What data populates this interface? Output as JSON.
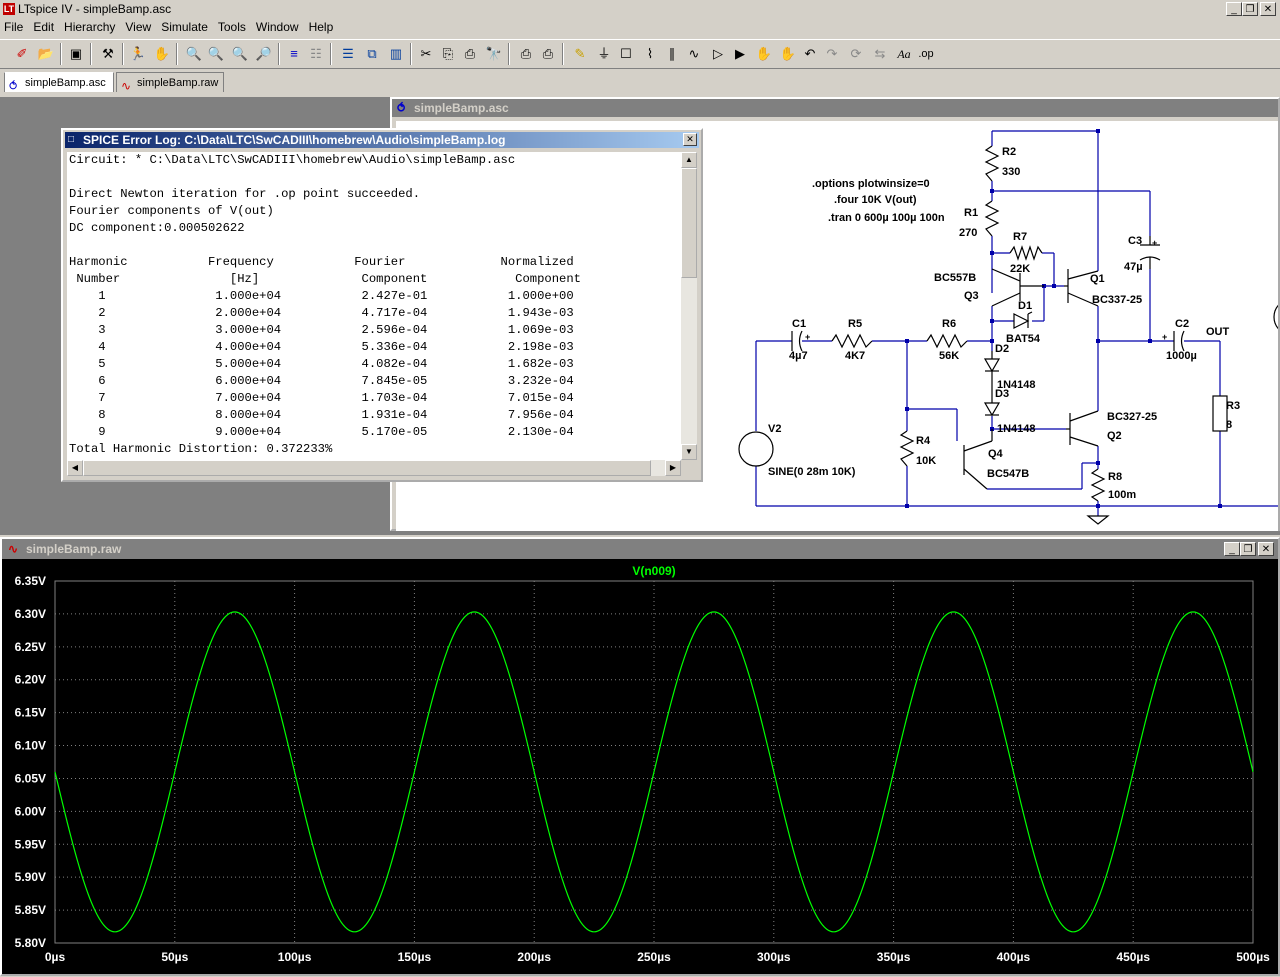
{
  "app": {
    "title": "LTspice IV - simpleBamp.asc",
    "logo_text": "LT"
  },
  "window_controls": {
    "minimize": "_",
    "restore": "❐",
    "close": "✕"
  },
  "menu": [
    "File",
    "Edit",
    "Hierarchy",
    "View",
    "Simulate",
    "Tools",
    "Window",
    "Help"
  ],
  "toolbar": {
    "icons": [
      "new-schematic-icon",
      "open-icon",
      "save-icon",
      "control-panel-icon",
      "run-icon",
      "halt-icon",
      "zoom-in-icon",
      "pan-icon",
      "zoom-out-icon",
      "zoom-fit-icon",
      "autorange-icon",
      "grid-icon",
      "tile-horizontal-icon",
      "cascade-icon",
      "tile-vertical-icon",
      "cut-icon",
      "copy-icon",
      "paste-icon",
      "find-icon",
      "print-setup-icon",
      "print-icon",
      "wire-icon",
      "ground-icon",
      "label-icon",
      "resistor-icon",
      "capacitor-icon",
      "inductor-icon",
      "diode-icon",
      "component-icon",
      "move-icon",
      "drag-icon",
      "undo-icon",
      "redo-icon",
      "rotate-icon",
      "mirror-icon",
      "text-icon",
      "spice-directive-icon"
    ],
    "text_aa": "Aa",
    "text_op": ".op"
  },
  "tabs": [
    {
      "label": "simpleBamp.asc",
      "active": true
    },
    {
      "label": "simpleBamp.raw",
      "active": false
    }
  ],
  "schematic_window": {
    "title": "simpleBamp.asc",
    "directives": [
      ".options plotwinsize=0",
      ".four 10K V(out)",
      ".tran 0 600µ 100µ 100n"
    ],
    "labels": {
      "R2": "R2",
      "R2v": "330",
      "R1": "R1",
      "R1v": "270",
      "R7": "R7",
      "R7v": "22K",
      "C3": "C3",
      "C3v": "47µ",
      "Q1": "Q1",
      "Q1v": "BC337-25",
      "Q3": "Q3",
      "Q3v": "BC557B",
      "D1": "D1",
      "D1v": "BAT54",
      "C1": "C1",
      "C1v": "4µ7",
      "R5": "R5",
      "R5v": "4K7",
      "R6": "R6",
      "R6v": "56K",
      "D2": "D2",
      "D2v": "1N4148",
      "D3": "D3",
      "D3v": "1N4148",
      "C2": "C2",
      "C2v": "1000µ",
      "OUT": "OUT",
      "R3": "R3",
      "R3v": "8",
      "Q2": "Q2",
      "Q2v": "BC327-25",
      "V2": "V2",
      "V2v": "SINE(0 28m 10K)",
      "R4": "R4",
      "R4v": "10K",
      "Q4": "Q4",
      "Q4v": "BC547B",
      "R8": "R8",
      "R8v": "100m",
      "plus": "+"
    }
  },
  "error_log": {
    "title": "SPICE Error Log: C:\\Data\\LTC\\SwCADIII\\homebrew\\Audio\\simpleBamp.log",
    "lines": [
      "Circuit: * C:\\Data\\LTC\\SwCADIII\\homebrew\\Audio\\simpleBamp.asc",
      "",
      "Direct Newton iteration for .op point succeeded.",
      "Fourier components of V(out)",
      "DC component:0.000502622",
      "",
      "Harmonic           Frequency           Fourier             Normalized",
      " Number               [Hz]              Component            Component",
      "    1               1.000e+04           2.427e-01           1.000e+00",
      "    2               2.000e+04           4.717e-04           1.943e-03",
      "    3               3.000e+04           2.596e-04           1.069e-03",
      "    4               4.000e+04           5.336e-04           2.198e-03",
      "    5               5.000e+04           4.082e-04           1.682e-03",
      "    6               6.000e+04           7.845e-05           3.232e-04",
      "    7               7.000e+04           1.703e-04           7.015e-04",
      "    8               8.000e+04           1.931e-04           7.956e-04",
      "    9               9.000e+04           5.170e-05           2.130e-04",
      "Total Harmonic Distortion: 0.372233%"
    ]
  },
  "waveform_window": {
    "title": "simpleBamp.raw"
  },
  "chart_data": {
    "type": "line",
    "title": "V(n009)",
    "series": [
      {
        "name": "V(n009)",
        "color": "#00ff00",
        "offset": 6.06,
        "amplitude": 0.243,
        "frequency_hz": 10000,
        "peak_time_us": 75
      }
    ],
    "xlabel": "",
    "ylabel": "",
    "xlim": [
      0,
      500
    ],
    "ylim": [
      5.8,
      6.35
    ],
    "x_ticks": [
      "0µs",
      "50µs",
      "100µs",
      "150µs",
      "200µs",
      "250µs",
      "300µs",
      "350µs",
      "400µs",
      "450µs",
      "500µs"
    ],
    "y_ticks": [
      "6.35V",
      "6.30V",
      "6.25V",
      "6.20V",
      "6.15V",
      "6.10V",
      "6.05V",
      "6.00V",
      "5.95V",
      "5.90V",
      "5.85V",
      "5.80V"
    ],
    "grid": true,
    "grid_color": "#808080",
    "background": "#000000",
    "axis_label_color": "#ffffff"
  }
}
